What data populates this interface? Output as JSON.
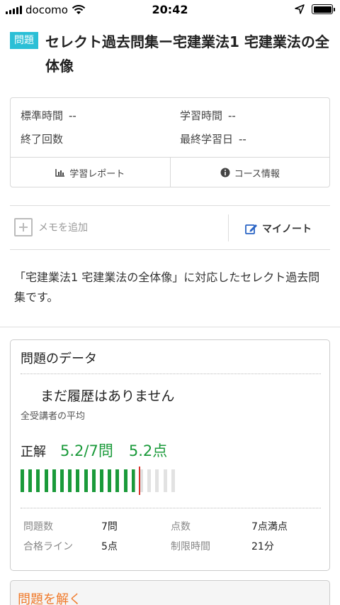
{
  "status_bar": {
    "carrier": "docomo",
    "time": "20:42"
  },
  "header": {
    "badge": "問題",
    "title": "セレクト過去問集ー宅建業法1 宅建業法の全体像"
  },
  "info": {
    "standard_time_label": "標準時間",
    "standard_time_value": "--",
    "study_time_label": "学習時間",
    "study_time_value": "--",
    "completed_label": "終了回数",
    "completed_value": "",
    "last_study_label": "最終学習日",
    "last_study_value": "--",
    "report_button": "学習レポート",
    "course_info_button": "コース情報"
  },
  "memo": {
    "add_label": "メモを追加",
    "mynote_label": "マイノート"
  },
  "description": "「宅建業法1 宅建業法の全体像」に対応したセレクト過去問集です。",
  "data_card": {
    "title": "問題のデータ",
    "no_history": "まだ履歴はありません",
    "average_label": "全受講者の平均",
    "correct_label": "正解",
    "correct_value": "5.2/7問",
    "points_value": "5.2点",
    "progress": {
      "fraction": 0.743,
      "segments": 20,
      "filled_color": "#1a9a3a",
      "empty_color": "#e2e2e2",
      "marker_color": "#d9342b"
    },
    "stats": {
      "questions_label": "問題数",
      "questions_value": "7問",
      "points_label": "点数",
      "points_value": "7点満点",
      "pass_label": "合格ライン",
      "pass_value": "5点",
      "time_limit_label": "制限時間",
      "time_limit_value": "21分"
    }
  },
  "solve": {
    "label": "問題を解く"
  },
  "colors": {
    "badge": "#2bbfd6",
    "accent_green": "#1a9a3a",
    "accent_orange": "#f07a2b"
  }
}
